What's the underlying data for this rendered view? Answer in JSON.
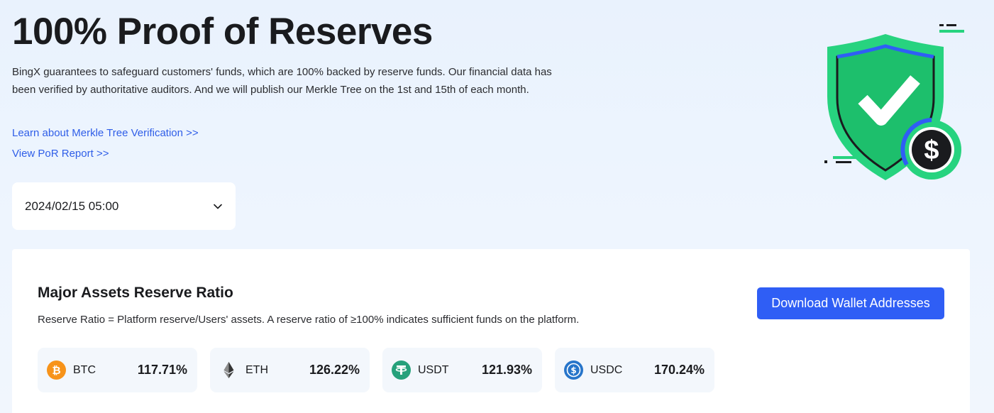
{
  "hero": {
    "title": "100% Proof of Reserves",
    "description": "BingX guarantees to safeguard customers' funds, which are 100% backed by reserve funds. Our financial data has been verified by authoritative auditors. And we will publish our Merkle Tree on the 1st and 15th of each month.",
    "link_merkle": "Learn about Merkle Tree Verification >>",
    "link_report": "View PoR Report >>",
    "illustration_icon": "shield-check-dollar-icon"
  },
  "date_select": {
    "value": "2024/02/15 05:00",
    "icon": "chevron-down-icon"
  },
  "reserve": {
    "title": "Major Assets Reserve Ratio",
    "subtitle": "Reserve Ratio = Platform reserve/Users' assets. A reserve ratio of ≥100% indicates sufficient funds on the platform.",
    "download_label": "Download Wallet Addresses",
    "assets": [
      {
        "symbol": "BTC",
        "ratio": "117.71%",
        "icon": "btc-icon",
        "color": "#f7931a"
      },
      {
        "symbol": "ETH",
        "ratio": "126.22%",
        "icon": "eth-icon",
        "color": "#343434"
      },
      {
        "symbol": "USDT",
        "ratio": "121.93%",
        "icon": "usdt-icon",
        "color": "#26a17b"
      },
      {
        "symbol": "USDC",
        "ratio": "170.24%",
        "icon": "usdc-icon",
        "color": "#2775ca"
      }
    ]
  },
  "colors": {
    "accent_blue": "#2f5ef5",
    "link_blue": "#2f5ee8",
    "shield_green": "#27d37f"
  }
}
